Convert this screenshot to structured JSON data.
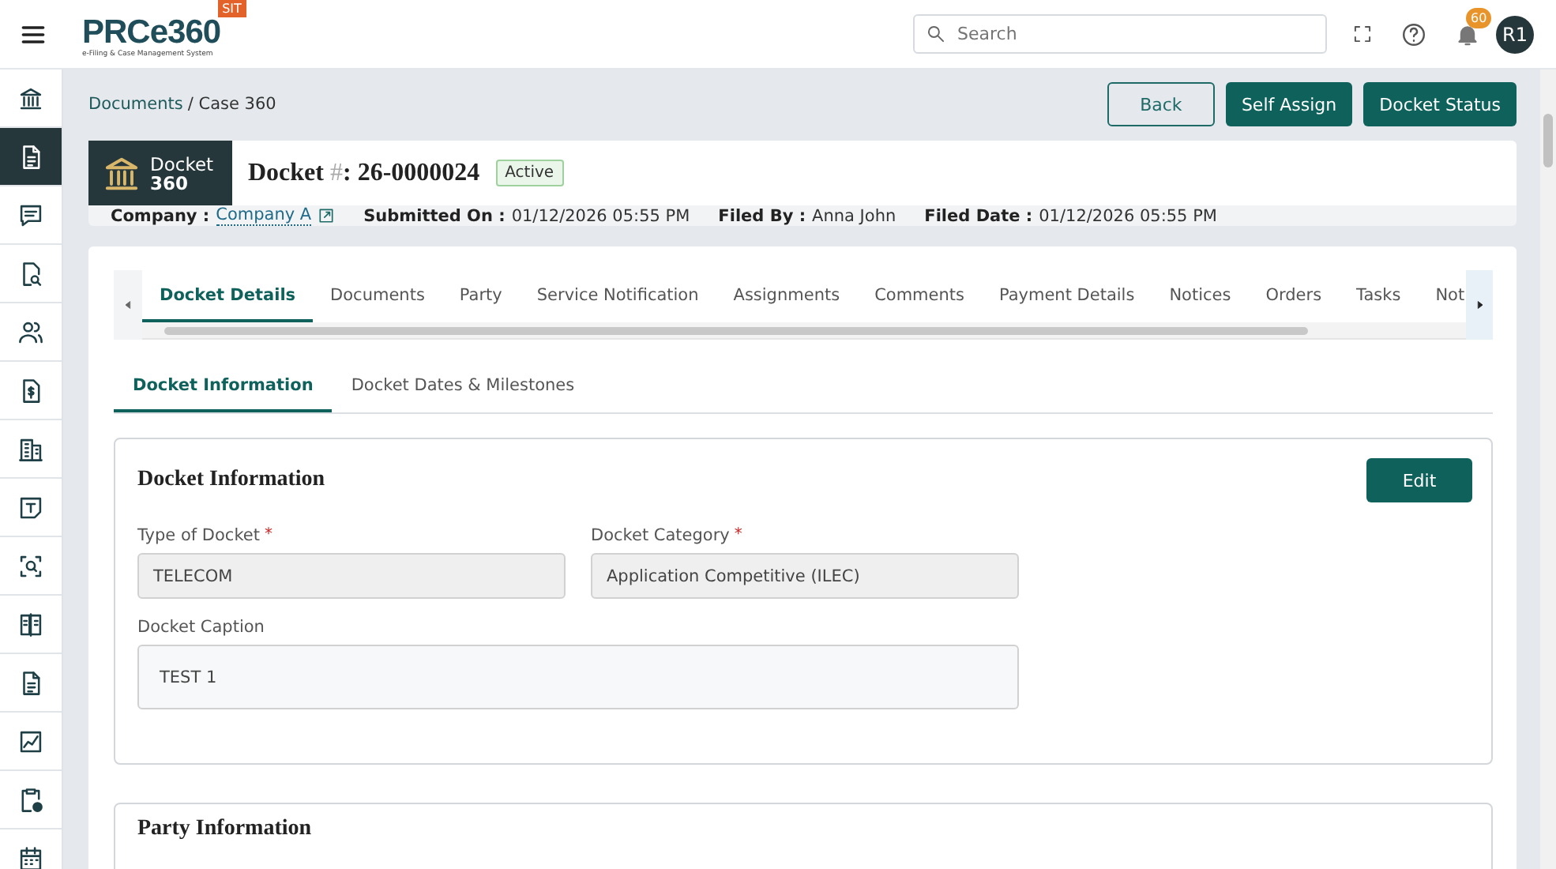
{
  "header": {
    "logo": "PRCe360",
    "logo_tagline": "e-Filing & Case Management System",
    "env_badge": "SIT",
    "search": {
      "placeholder": "Search"
    },
    "notification_count": "60",
    "avatar": "R1"
  },
  "sidebar": {
    "items": [
      {
        "kind": "bank",
        "selected": false
      },
      {
        "kind": "document",
        "selected": true
      },
      {
        "kind": "chat",
        "selected": false
      },
      {
        "kind": "doc-search",
        "selected": false
      },
      {
        "kind": "users",
        "selected": false
      },
      {
        "kind": "invoice",
        "selected": false
      },
      {
        "kind": "building",
        "selected": false
      },
      {
        "kind": "text-doc",
        "selected": false
      },
      {
        "kind": "scan",
        "selected": false
      },
      {
        "kind": "book",
        "selected": false
      },
      {
        "kind": "document",
        "selected": false
      },
      {
        "kind": "chart",
        "selected": false
      },
      {
        "kind": "clipboard",
        "selected": false
      },
      {
        "kind": "calendar",
        "selected": false
      }
    ]
  },
  "breadcrumb": [
    {
      "label": "Documents",
      "kind": "link"
    },
    {
      "label": "/ Case 360",
      "kind": "text"
    }
  ],
  "actions": [
    {
      "label": "Back",
      "kind": "outline"
    },
    {
      "label": "Self Assign",
      "kind": "primary"
    },
    {
      "label": "Docket Status",
      "kind": "primary"
    }
  ],
  "docket": {
    "badge_line1": "Docket",
    "badge_line2": "360",
    "title": "Docket",
    "hash": "#",
    "number": ": 26-0000024",
    "status": "Active"
  },
  "info": [
    {
      "label": "Company :",
      "value": "Company A",
      "kind": "link"
    },
    {
      "label": "Submitted On :",
      "value": "01/12/2026 05:55 PM",
      "kind": "text"
    },
    {
      "label": "Filed By :",
      "value": "Anna John",
      "kind": "text"
    },
    {
      "label": "Filed Date :",
      "value": "01/12/2026 05:55 PM",
      "kind": "text"
    }
  ],
  "tabs": [
    {
      "label": "Docket Details",
      "selected": true
    },
    {
      "label": "Documents",
      "selected": false
    },
    {
      "label": "Party",
      "selected": false
    },
    {
      "label": "Service Notification",
      "selected": false
    },
    {
      "label": "Assignments",
      "selected": false
    },
    {
      "label": "Comments",
      "selected": false
    },
    {
      "label": "Payment Details",
      "selected": false
    },
    {
      "label": "Notices",
      "selected": false
    },
    {
      "label": "Orders",
      "selected": false
    },
    {
      "label": "Tasks",
      "selected": false
    },
    {
      "label": "Not",
      "selected": false
    }
  ],
  "subtabs": [
    {
      "label": "Docket Information",
      "selected": true
    },
    {
      "label": "Docket Dates & Milestones",
      "selected": false
    }
  ],
  "section": {
    "title": "Docket Information",
    "edit": "Edit",
    "fields": [
      {
        "label": "Type of Docket",
        "required_mark": "*",
        "value": "TELECOM",
        "kind": "select"
      },
      {
        "label": "Docket Category",
        "required_mark": "*",
        "value": "Application Competitive (ILEC)",
        "kind": "select"
      },
      {
        "label": "Docket Caption",
        "value": "TEST 1",
        "kind": "textarea"
      }
    ]
  },
  "next_section": {
    "title": "Party Information"
  }
}
